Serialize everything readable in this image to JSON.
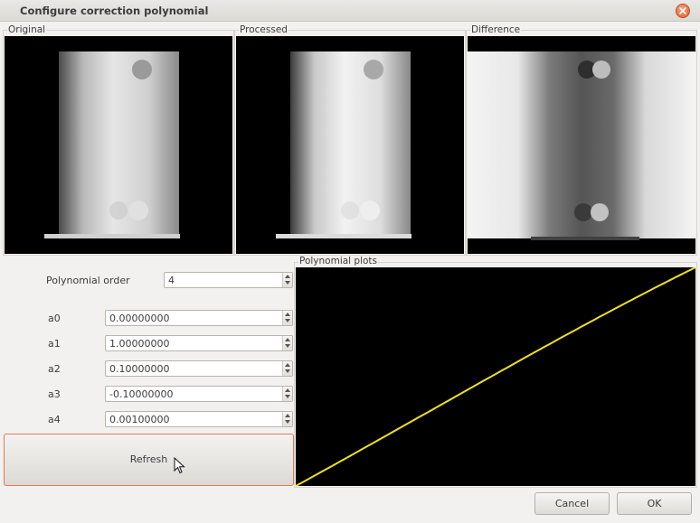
{
  "window": {
    "title": "Configure correction polynomial"
  },
  "views": {
    "original_label": "Original",
    "processed_label": "Processed",
    "difference_label": "Difference"
  },
  "form": {
    "order_label": "Polynomial order",
    "order_value": "4",
    "coefficients": [
      {
        "label": "a0",
        "value": "0.00000000"
      },
      {
        "label": "a1",
        "value": "1.00000000"
      },
      {
        "label": "a2",
        "value": "0.10000000"
      },
      {
        "label": "a3",
        "value": "-0.10000000"
      },
      {
        "label": "a4",
        "value": "0.00100000"
      }
    ],
    "refresh_label": "Refresh"
  },
  "plot": {
    "label": "Polynomial plots",
    "curve_color": "#f0e020",
    "background": "#000000"
  },
  "buttons": {
    "cancel_label": "Cancel",
    "ok_label": "OK"
  }
}
